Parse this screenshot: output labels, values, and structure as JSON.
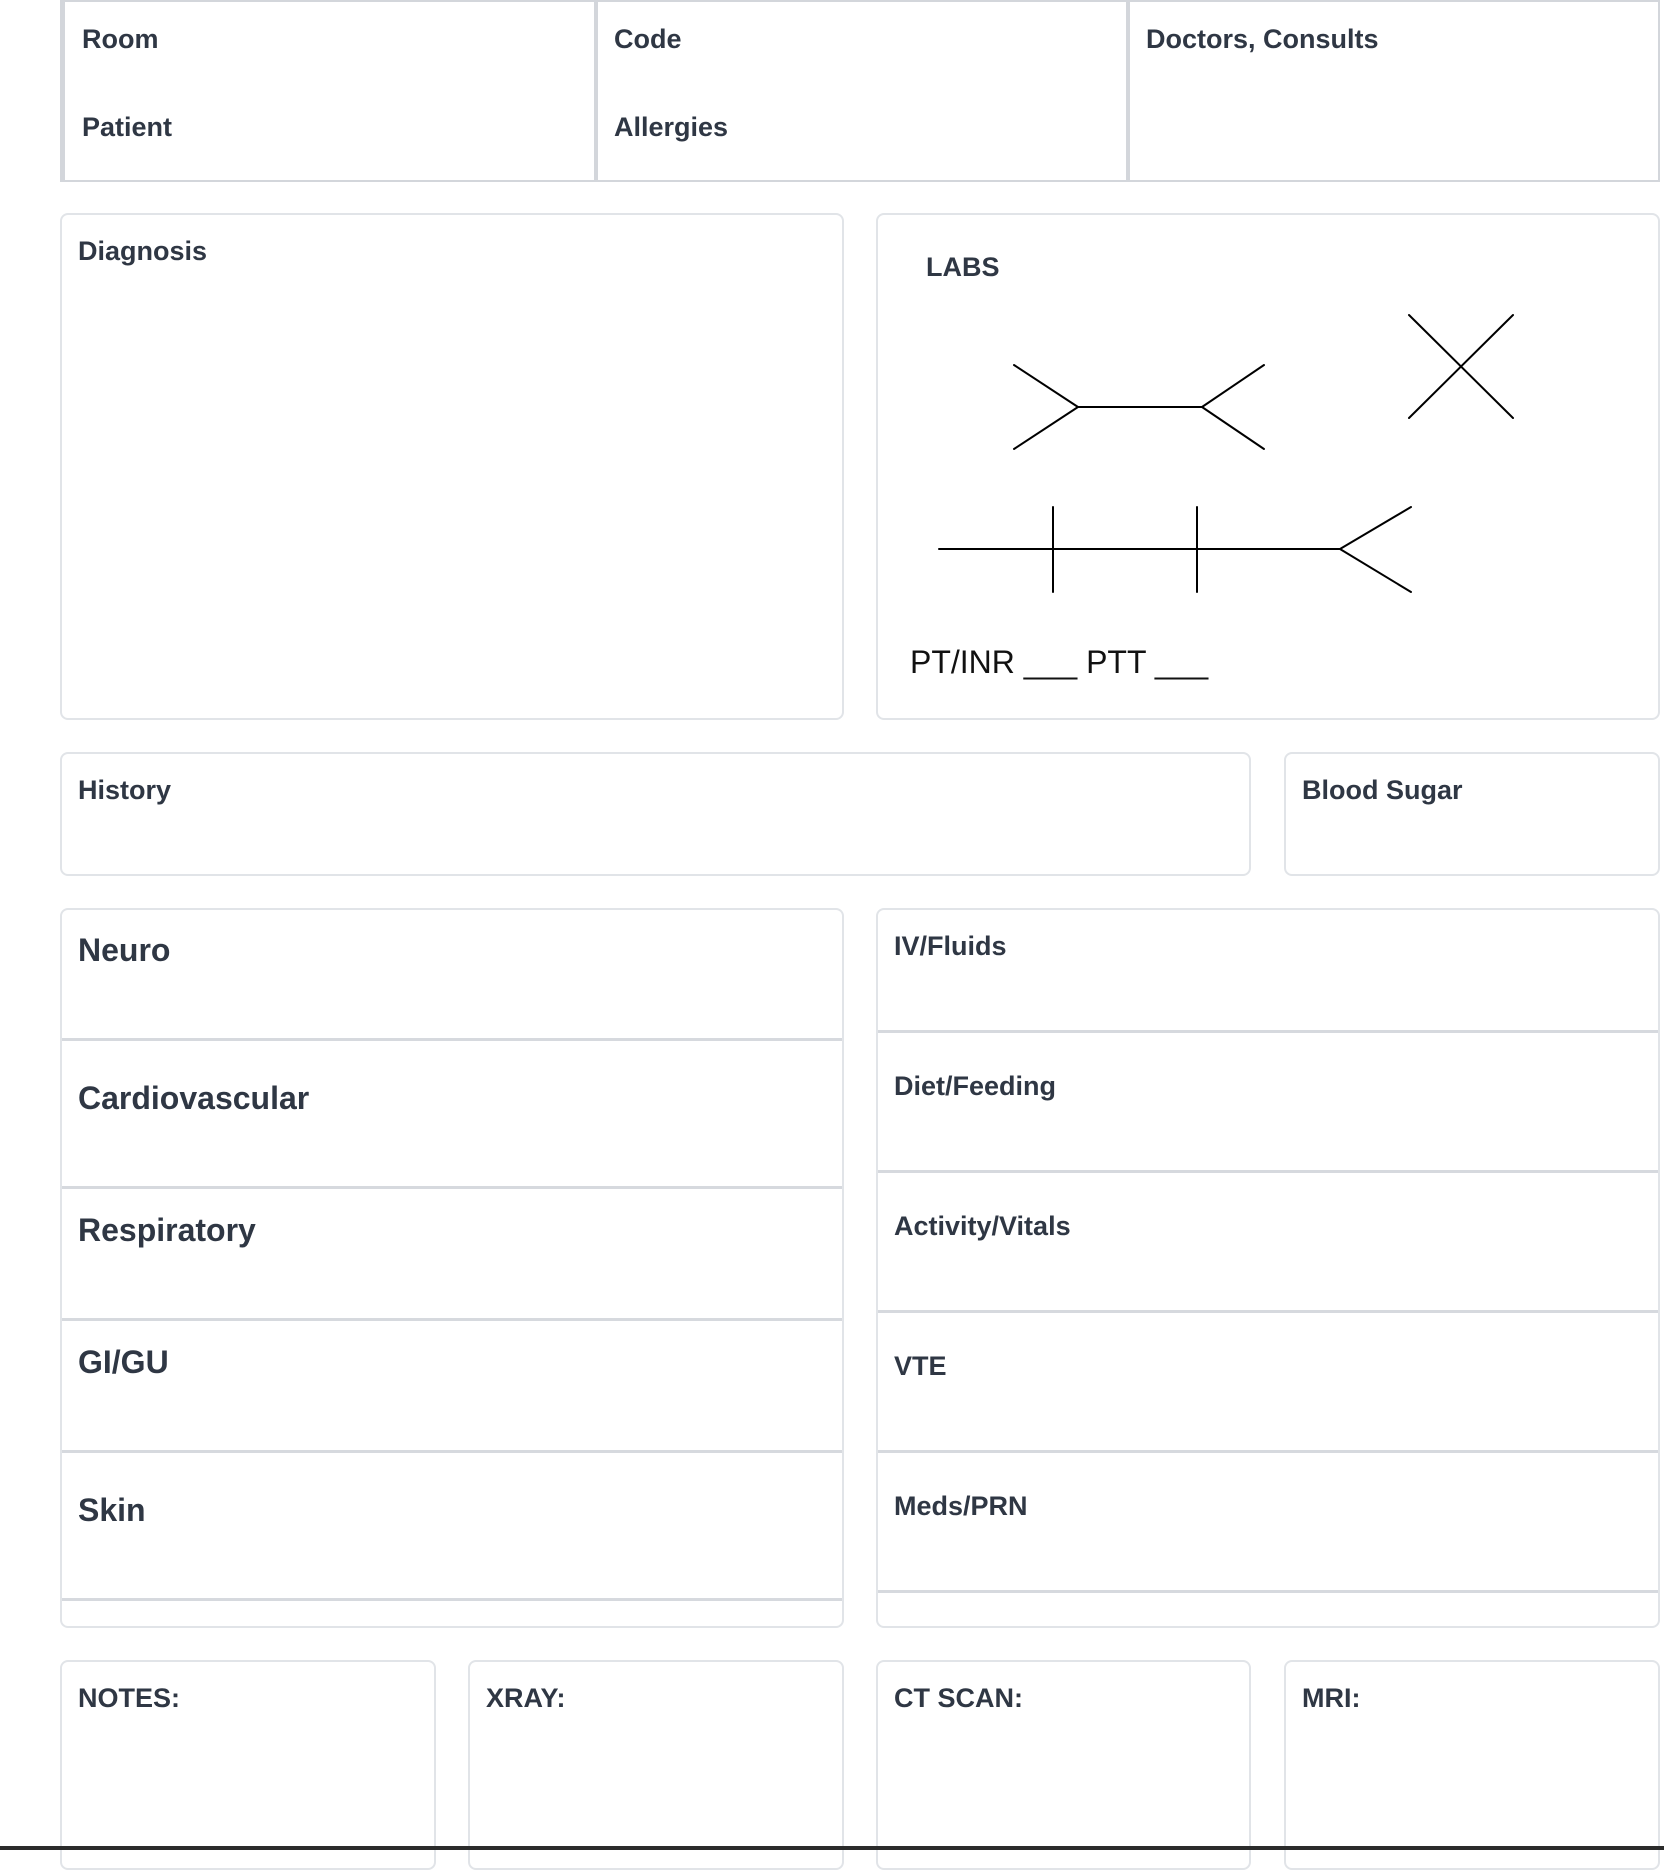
{
  "header": {
    "room": "Room",
    "patient": "Patient",
    "code": "Code",
    "allergies": "Allergies",
    "doctors": "Doctors, Consults"
  },
  "diagnosis": {
    "label": "Diagnosis"
  },
  "labs": {
    "label": "LABS",
    "coag_line": "PT/INR ___ PTT ___"
  },
  "history": {
    "label": "History"
  },
  "blood_sugar": {
    "label": "Blood Sugar"
  },
  "systems": [
    "Neuro",
    "Cardiovascular",
    "Respiratory",
    "GI/GU",
    "Skin"
  ],
  "care": [
    "IV/Fluids",
    "Diet/Feeding",
    "Activity/Vitals",
    "VTE",
    "Meds/PRN"
  ],
  "imaging": {
    "notes": "NOTES:",
    "xray": "XRAY:",
    "ct": "CT SCAN:",
    "mri": "MRI:"
  }
}
